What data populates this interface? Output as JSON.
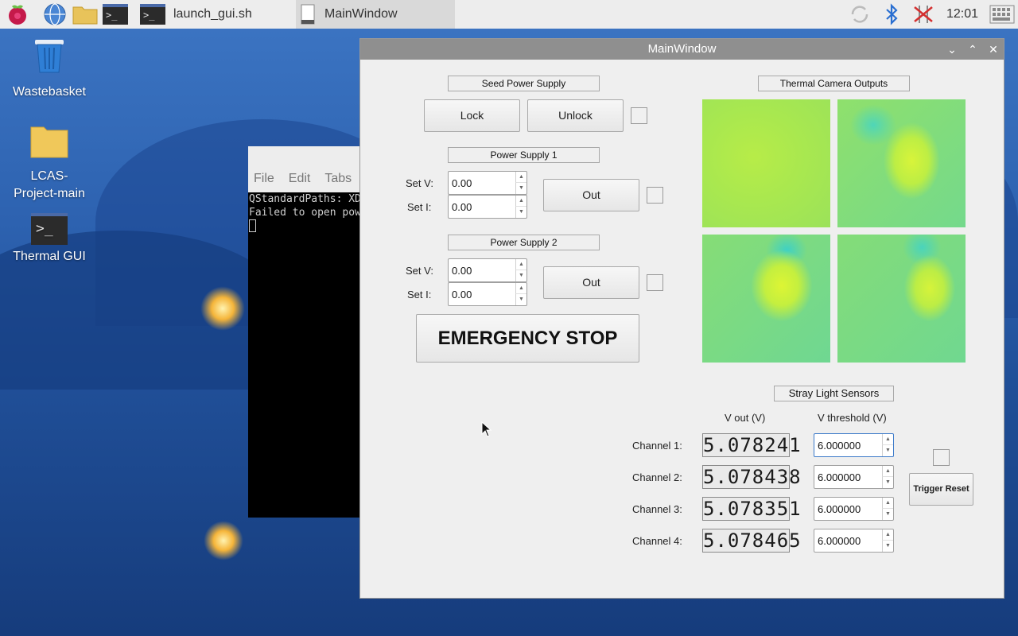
{
  "taskbar": {
    "tasks": [
      "launch_gui.sh",
      "MainWindow"
    ],
    "clock": "12:01"
  },
  "desktop": {
    "icons": [
      {
        "label": "Wastebasket"
      },
      {
        "label": "LCAS-Project-main"
      },
      {
        "label": "Thermal GUI"
      }
    ]
  },
  "terminal": {
    "menu": [
      "File",
      "Edit",
      "Tabs"
    ],
    "lines": [
      "QStandardPaths: XD",
      "Failed to open pow"
    ]
  },
  "window": {
    "title": "MainWindow",
    "seed": {
      "title": "Seed Power Supply",
      "lock_label": "Lock",
      "unlock_label": "Unlock"
    },
    "ps1": {
      "title": "Power Supply 1",
      "setv_label": "Set V:",
      "seti_label": "Set I:",
      "setv_value": "0.00",
      "seti_value": "0.00",
      "out_label": "Out"
    },
    "ps2": {
      "title": "Power Supply 2",
      "setv_label": "Set V:",
      "seti_label": "Set I:",
      "setv_value": "0.00",
      "seti_value": "0.00",
      "out_label": "Out"
    },
    "estop_label": "EMERGENCY STOP",
    "thermal": {
      "title": "Thermal Camera Outputs"
    },
    "stray": {
      "title": "Stray Light Sensors",
      "vout_header": "V out (V)",
      "vthresh_header": "V threshold (V)",
      "channels": [
        {
          "label": "Channel 1:",
          "vout": "5.078241",
          "threshold": "6.000000"
        },
        {
          "label": "Channel 2:",
          "vout": "5.078438",
          "threshold": "6.000000"
        },
        {
          "label": "Channel 3:",
          "vout": "5.078351",
          "threshold": "6.000000"
        },
        {
          "label": "Channel 4:",
          "vout": "5.078465",
          "threshold": "6.000000"
        }
      ],
      "trigger_reset_label": "Trigger Reset"
    }
  }
}
